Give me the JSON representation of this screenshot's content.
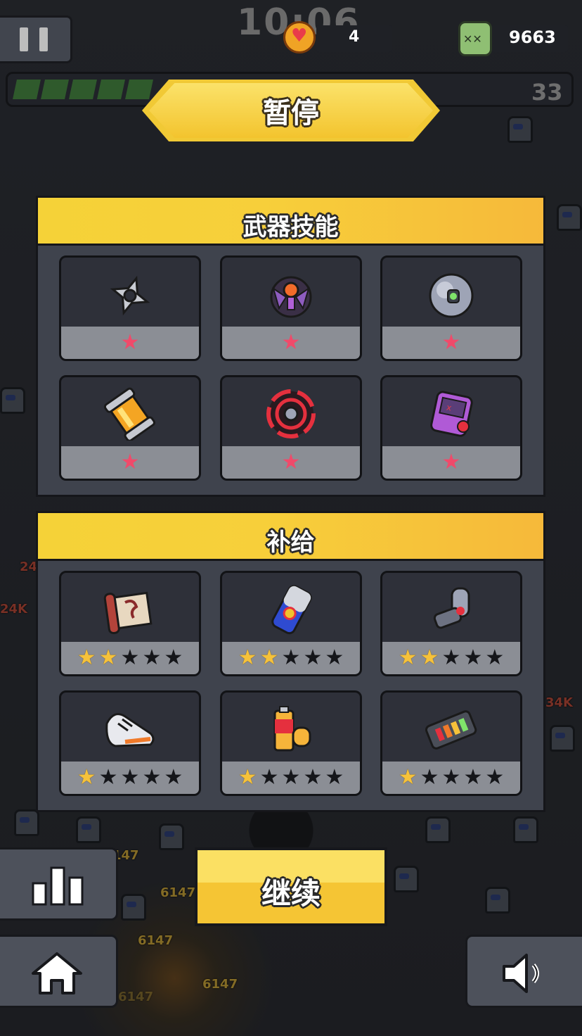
{
  "hud": {
    "timer": "10:06",
    "lives": "4",
    "kills": "9663",
    "level": "33",
    "xp_progress": 0.25,
    "heart_icon": "heart-icon",
    "skull_icon": "skull-icon"
  },
  "background": {
    "damage_numbers": [
      "24K",
      "24",
      "34K",
      "6147",
      "6147",
      "6147",
      "6147",
      "147"
    ]
  },
  "pause_title": "暂停",
  "weapons": {
    "title": "武器技能",
    "items": [
      {
        "icon": "shuriken-icon",
        "stars": 1
      },
      {
        "icon": "drone-icon",
        "stars": 1
      },
      {
        "icon": "orb-icon",
        "stars": 1
      },
      {
        "icon": "canister-icon",
        "stars": 1
      },
      {
        "icon": "forcefield-icon",
        "stars": 1
      },
      {
        "icon": "gameboy-icon",
        "stars": 1
      }
    ]
  },
  "supplies": {
    "title": "补给",
    "max_stars": 5,
    "items": [
      {
        "icon": "scroll-icon",
        "stars": 2
      },
      {
        "icon": "energy-drink-icon",
        "stars": 2
      },
      {
        "icon": "robot-arm-icon",
        "stars": 2
      },
      {
        "icon": "sneaker-icon",
        "stars": 1
      },
      {
        "icon": "battery-icon",
        "stars": 1
      },
      {
        "icon": "power-cell-icon",
        "stars": 1
      }
    ]
  },
  "buttons": {
    "continue": "继续",
    "stats_icon": "bar-chart-icon",
    "home_icon": "home-icon",
    "sound_icon": "speaker-icon"
  },
  "colors": {
    "accent": "#f5c534",
    "star_gold": "#f6c23a",
    "star_pink": "#f04a6a",
    "panel": "#3f434d"
  }
}
